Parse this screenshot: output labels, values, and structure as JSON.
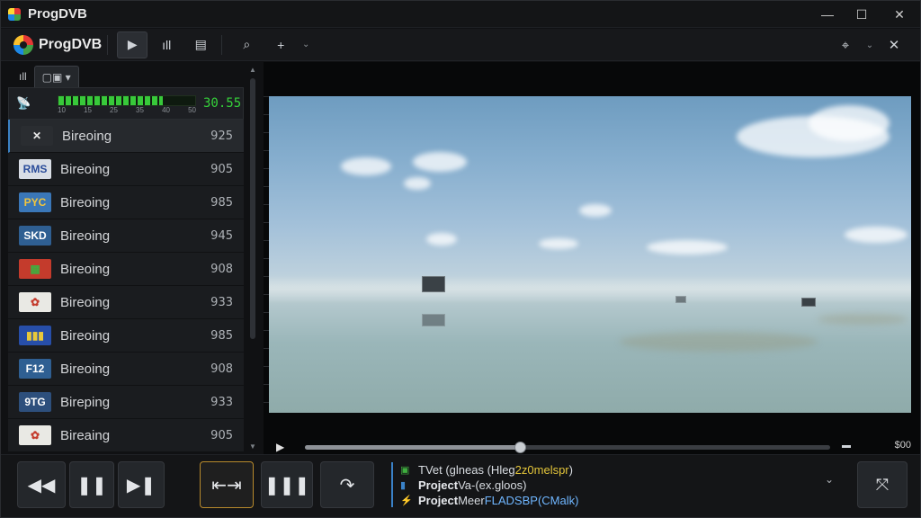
{
  "window": {
    "title": "ProgDVB",
    "minimize_label": "—",
    "maximize_label": "☐",
    "close_label": "✕"
  },
  "toolbar": {
    "logo_text": "ProgDVB",
    "buttons": [
      "▶",
      "ıll",
      "▤",
      "⌕",
      "+",
      "⌄"
    ],
    "right_buttons": [
      "⌖",
      "⌄",
      "✕"
    ]
  },
  "left_panel": {
    "tabs": [
      {
        "label": "ıll"
      },
      {
        "label": "▢▣ ▾"
      }
    ],
    "signal": {
      "antenna_icon": "antenna-icon",
      "value": "30.55",
      "level": 0.76,
      "scale_labels": [
        "10",
        "15",
        "25",
        "35",
        "40",
        "50"
      ]
    },
    "channels": [
      {
        "logo": "✕",
        "logo_bg": "#2a2d31",
        "logo_fg": "#e8e8e8",
        "name": "Bireoing",
        "number": "925"
      },
      {
        "logo": "RMS",
        "logo_bg": "#d9dee6",
        "logo_fg": "#2a4c9a",
        "name": "Bireoing",
        "number": "905"
      },
      {
        "logo": "PYC",
        "logo_bg": "#3a77b8",
        "logo_fg": "#f2c53d",
        "name": "Bireoing",
        "number": "985"
      },
      {
        "logo": "SKD",
        "logo_bg": "#2f5f92",
        "logo_fg": "#ffffff",
        "name": "Bireoing",
        "number": "945"
      },
      {
        "logo": "▦",
        "logo_bg": "#c43b2c",
        "logo_fg": "#3fae3f",
        "name": "Bireoing",
        "number": "908"
      },
      {
        "logo": "✿",
        "logo_bg": "#e9e9e4",
        "logo_fg": "#c43b2c",
        "name": "Bireoing",
        "number": "933"
      },
      {
        "logo": "▮▮▮",
        "logo_bg": "#274ea8",
        "logo_fg": "#e8c83a",
        "name": "Bireoing",
        "number": "985"
      },
      {
        "logo": "F12",
        "logo_bg": "#2f5f92",
        "logo_fg": "#ffffff",
        "name": "Bireoing",
        "number": "908"
      },
      {
        "logo": "9TG",
        "logo_bg": "#2d4f7c",
        "logo_fg": "#ffffff",
        "name": "Bireping",
        "number": "933"
      },
      {
        "logo": "✿",
        "logo_bg": "#e9e9e4",
        "logo_fg": "#c43b2c",
        "name": "Bireaing",
        "number": "905"
      }
    ]
  },
  "player": {
    "progress": 0.41,
    "time_text": "$00",
    "play_icon": "▶",
    "volume_icon": "▬"
  },
  "controls": {
    "rewind": "◀◀",
    "pause": "❚❚",
    "next": "▶❚",
    "aspect": "⇤⇥",
    "stop": "❚❚❚",
    "forward": "↷",
    "fullscreen": "⤧"
  },
  "info": {
    "line1": {
      "icon": "▣",
      "color": "#3fae3f",
      "prefix": "TVet (glneas (Hleg ",
      "highlight": "2z0melspr",
      "suffix": ")"
    },
    "line2": {
      "icon": "▮",
      "color": "#3a82c8",
      "label": "Project",
      "text": " Va-(ex.gloos)"
    },
    "line3": {
      "icon": "⚡",
      "color": "#2aa59a",
      "label": "Project",
      "text": " Meer ",
      "highlight": "FLADSBP(CMalk)"
    },
    "chevron": "⌄"
  }
}
